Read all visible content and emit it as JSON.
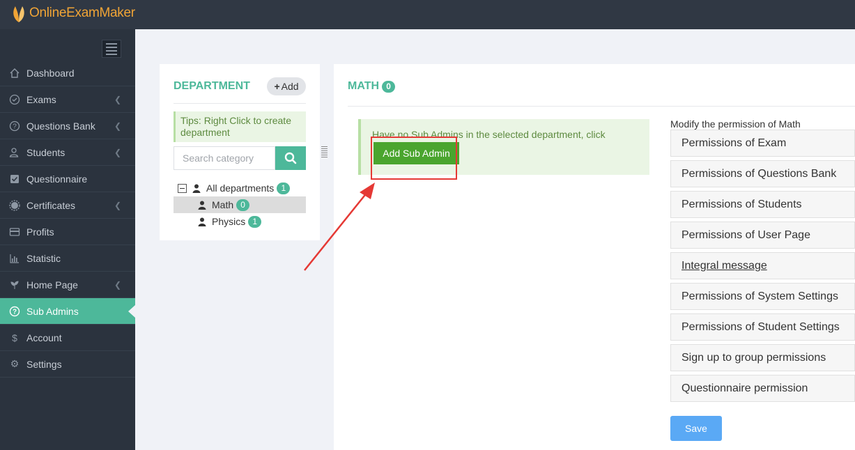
{
  "app": {
    "logo_text": "OnlineExamMaker"
  },
  "sidebar": {
    "items": [
      {
        "label": "Dashboard",
        "icon": "home-icon",
        "has_submenu": false
      },
      {
        "label": "Exams",
        "icon": "check-circle-icon",
        "has_submenu": true
      },
      {
        "label": "Questions Bank",
        "icon": "question-circle-icon",
        "has_submenu": true
      },
      {
        "label": "Students",
        "icon": "users-icon",
        "has_submenu": true
      },
      {
        "label": "Questionnaire",
        "icon": "checkbox-icon",
        "has_submenu": false
      },
      {
        "label": "Certificates",
        "icon": "certificate-icon",
        "has_submenu": true
      },
      {
        "label": "Profits",
        "icon": "credit-card-icon",
        "has_submenu": false
      },
      {
        "label": "Statistic",
        "icon": "bar-chart-icon",
        "has_submenu": false
      },
      {
        "label": "Home Page",
        "icon": "leaf-icon",
        "has_submenu": true
      },
      {
        "label": "Sub Admins",
        "icon": "question-circle-icon",
        "has_submenu": false,
        "active": true
      },
      {
        "label": "Account",
        "icon": "dollar-icon",
        "has_submenu": false
      },
      {
        "label": "Settings",
        "icon": "gear-icon",
        "has_submenu": false
      }
    ],
    "active_color": "#4db89a"
  },
  "department": {
    "title": "DEPARTMENT",
    "add_label": "Add",
    "tips": "Tips: Right Click to create department",
    "search_placeholder": "Search category",
    "tree": [
      {
        "label": "All departments",
        "count": "1"
      },
      {
        "label": "Math",
        "count": "0",
        "selected": true
      },
      {
        "label": "Physics",
        "count": "1"
      }
    ]
  },
  "main": {
    "title": "MATH",
    "count": "0",
    "notice_text": "Have no Sub Admins in the selected department, click",
    "add_sub_admin_label": "Add Sub Admin",
    "permissions_title": "Modify the permission of Math",
    "permissions": [
      "Permissions of Exam",
      "Permissions of Questions Bank",
      "Permissions of Students",
      "Permissions of User Page",
      "Integral message",
      "Permissions of System Settings",
      "Permissions of Student Settings",
      "Sign up to group permissions",
      "Questionnaire permission"
    ],
    "save_label": "Save"
  },
  "colors": {
    "accent": "#4db89a",
    "topbar": "#303844",
    "sidebar": "#2b333e",
    "annotation": "#e53935",
    "save": "#5aa9f5"
  }
}
